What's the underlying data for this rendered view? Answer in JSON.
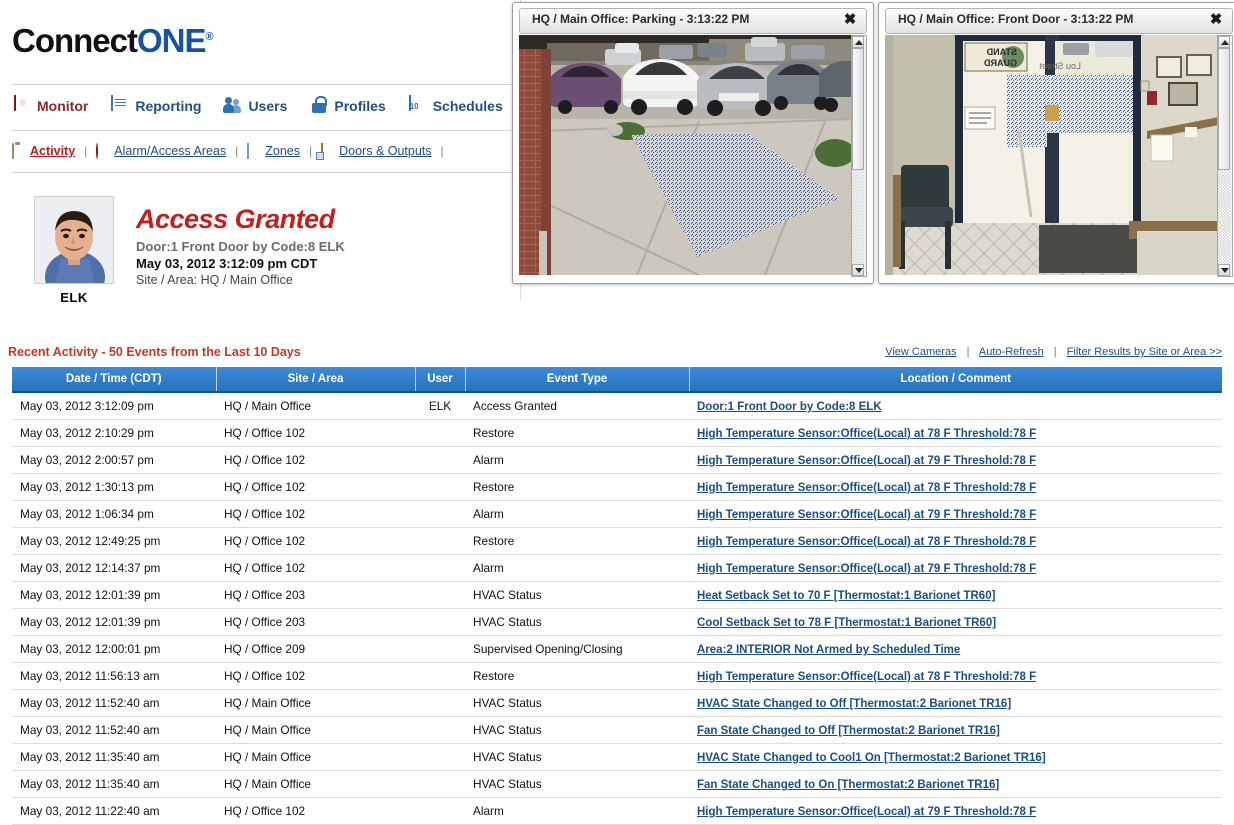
{
  "brand": {
    "part1": "Connect",
    "part2": "ONE",
    "registered": "®"
  },
  "main_nav": [
    {
      "label": "Monitor",
      "icon": "shield-icon",
      "active": true
    },
    {
      "label": "Reporting",
      "icon": "report-icon",
      "active": false
    },
    {
      "label": "Users",
      "icon": "users-icon",
      "active": false
    },
    {
      "label": "Profiles",
      "icon": "lock-icon",
      "active": false
    },
    {
      "label": "Schedules",
      "icon": "calendar-icon",
      "active": false
    }
  ],
  "calendar_icon_day": "10",
  "sub_nav": [
    {
      "label": "Activity",
      "icon": "clipboard-icon",
      "active": true
    },
    {
      "label": "Alarm/Access Areas",
      "icon": "bell-icon",
      "active": false
    },
    {
      "label": "Zones",
      "icon": "document-icon",
      "active": false
    },
    {
      "label": "Doors & Outputs",
      "icon": "door-icon",
      "active": false
    }
  ],
  "sub_nav_separator": "|",
  "event_banner": {
    "user_name": "ELK",
    "title": "Access Granted",
    "door": "Door:1 Front Door by Code:8 ELK",
    "datetime": "May 03, 2012 3:12:09 pm CDT",
    "site_area": "Site / Area: HQ / Main Office"
  },
  "cameras": [
    {
      "title": "HQ / Main Office: Parking - 3:13:22 PM",
      "close_label": "✖",
      "view": "parking"
    },
    {
      "title": "HQ / Main Office: Front Door - 3:13:22 PM",
      "close_label": "✖",
      "view": "front-door"
    }
  ],
  "recent_activity": {
    "heading": "Recent Activity - 50 Events from the Last 10 Days",
    "links": [
      {
        "label": "View Cameras"
      },
      {
        "label": "Auto-Refresh"
      },
      {
        "label": "Filter Results by Site or Area >>"
      }
    ],
    "link_separator": "|",
    "columns": [
      "Date / Time (CDT)",
      "Site / Area",
      "User",
      "Event Type",
      "Location / Comment"
    ],
    "rows": [
      {
        "datetime": "May 03, 2012 3:12:09 pm",
        "site": "HQ / Main Office",
        "user": "ELK",
        "event": "Access Granted",
        "location": "Door:1 Front Door by Code:8 ELK"
      },
      {
        "datetime": "May 03, 2012 2:10:29 pm",
        "site": "HQ / Office 102",
        "user": "",
        "event": "Restore",
        "location": "High Temperature Sensor:Office(Local) at 78 F Threshold:78 F"
      },
      {
        "datetime": "May 03, 2012 2:00:57 pm",
        "site": "HQ / Office 102",
        "user": "",
        "event": "Alarm",
        "location": "High Temperature Sensor:Office(Local) at 79 F Threshold:78 F"
      },
      {
        "datetime": "May 03, 2012 1:30:13 pm",
        "site": "HQ / Office 102",
        "user": "",
        "event": "Restore",
        "location": "High Temperature Sensor:Office(Local) at 78 F Threshold:78 F"
      },
      {
        "datetime": "May 03, 2012 1:06:34 pm",
        "site": "HQ / Office 102",
        "user": "",
        "event": "Alarm",
        "location": "High Temperature Sensor:Office(Local) at 79 F Threshold:78 F"
      },
      {
        "datetime": "May 03, 2012 12:49:25 pm",
        "site": "HQ / Office 102",
        "user": "",
        "event": "Restore",
        "location": "High Temperature Sensor:Office(Local) at 78 F Threshold:78 F"
      },
      {
        "datetime": "May 03, 2012 12:14:37 pm",
        "site": "HQ / Office 102",
        "user": "",
        "event": "Alarm",
        "location": "High Temperature Sensor:Office(Local) at 79 F Threshold:78 F"
      },
      {
        "datetime": "May 03, 2012 12:01:39 pm",
        "site": "HQ / Office 203",
        "user": "",
        "event": "HVAC Status",
        "location": "Heat Setback Set to 70 F [Thermostat:1 Barionet TR60]"
      },
      {
        "datetime": "May 03, 2012 12:01:39 pm",
        "site": "HQ / Office 203",
        "user": "",
        "event": "HVAC Status",
        "location": "Cool Setback Set to 78 F [Thermostat:1 Barionet TR60]"
      },
      {
        "datetime": "May 03, 2012 12:00:01 pm",
        "site": "HQ / Office 209",
        "user": "",
        "event": "Supervised Opening/Closing",
        "location": "Area:2 INTERIOR Not Armed by Scheduled Time"
      },
      {
        "datetime": "May 03, 2012 11:56:13 am",
        "site": "HQ / Office 102",
        "user": "",
        "event": "Restore",
        "location": "High Temperature Sensor:Office(Local) at 78 F Threshold:78 F"
      },
      {
        "datetime": "May 03, 2012 11:52:40 am",
        "site": "HQ / Main Office",
        "user": "",
        "event": "HVAC Status",
        "location": "HVAC State Changed to Off [Thermostat:2 Barionet TR16]"
      },
      {
        "datetime": "May 03, 2012 11:52:40 am",
        "site": "HQ / Main Office",
        "user": "",
        "event": "HVAC Status",
        "location": "Fan State Changed to Off [Thermostat:2 Barionet TR16]"
      },
      {
        "datetime": "May 03, 2012 11:35:40 am",
        "site": "HQ / Main Office",
        "user": "",
        "event": "HVAC Status",
        "location": "HVAC State Changed to Cool1 On [Thermostat:2 Barionet TR16]"
      },
      {
        "datetime": "May 03, 2012 11:35:40 am",
        "site": "HQ / Main Office",
        "user": "",
        "event": "HVAC Status",
        "location": "Fan State Changed to On [Thermostat:2 Barionet TR16]"
      },
      {
        "datetime": "May 03, 2012 11:22:40 am",
        "site": "HQ / Office 102",
        "user": "",
        "event": "Alarm",
        "location": "High Temperature Sensor:Office(Local) at 79 F Threshold:78 F"
      }
    ]
  },
  "colors": {
    "brand_blue": "#15539e",
    "accent_red": "#c21f1f",
    "header_blue": "#2573bf",
    "link_blue": "#1a4f86",
    "heading_red": "#c0392b"
  }
}
